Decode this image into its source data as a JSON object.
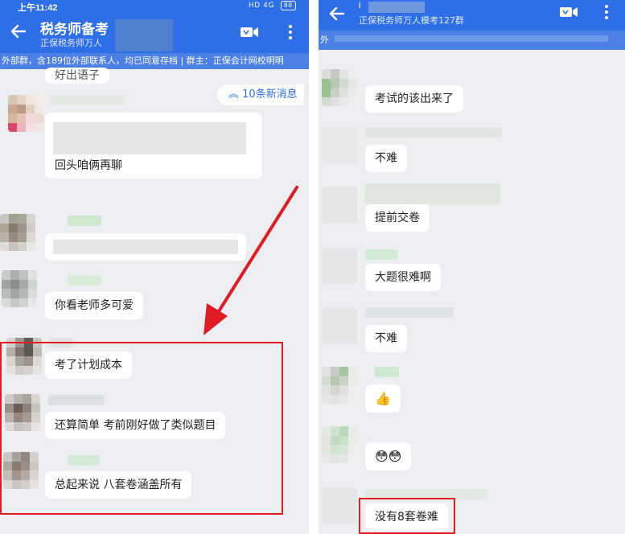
{
  "left": {
    "status": {
      "time": "上午11:42",
      "network": "HD 4G",
      "battery": "88"
    },
    "header": {
      "title": "税务师备考",
      "subtitle": "正保税务师万人"
    },
    "notice": "外部群，含189位外部联系人，均已同意存档 | 群主：正保会计网校明明",
    "new_messages": "10条新消息",
    "messages": [
      {
        "text": "好出语子"
      },
      {
        "text": "回头咱俩再聊"
      },
      {
        "text": ""
      },
      {
        "text": "你看老师多可爱"
      },
      {
        "text": "考了计划成本"
      },
      {
        "text": "还算简单 考前刚好做了类似题目"
      },
      {
        "text": "总起来说 八套卷涵盖所有"
      }
    ]
  },
  "right": {
    "header": {
      "title": "i",
      "subtitle": "正保税务师万人模考127群"
    },
    "notice": "外",
    "messages": [
      {
        "text": "考试的该出来了"
      },
      {
        "text": "不难"
      },
      {
        "text": "提前交卷"
      },
      {
        "text": "大题很难啊"
      },
      {
        "text": "不难"
      },
      {
        "text": "👍"
      },
      {
        "text": "😳😳"
      },
      {
        "text": "没有8套卷难"
      }
    ]
  },
  "colors": {
    "header_blue": "#2e6ee6",
    "highlight_red": "#e01b24",
    "chat_bg": "#eceef1"
  }
}
